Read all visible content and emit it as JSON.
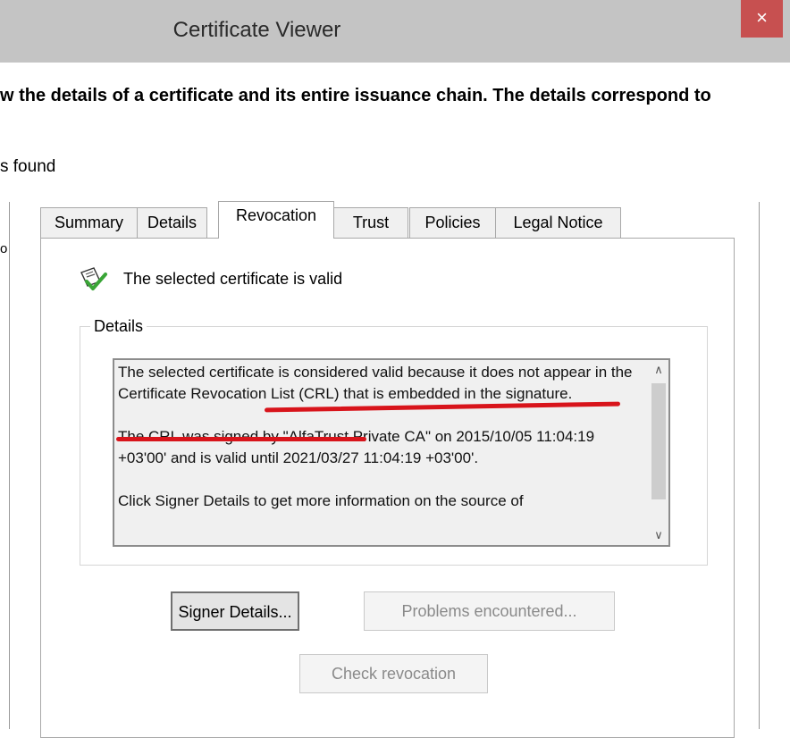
{
  "window": {
    "title": "Certificate Viewer",
    "close_label": "×"
  },
  "intro_text": "w the details of a certificate and its entire issuance chain. The details correspond to",
  "found_text": "s found",
  "left_glyph": "o",
  "tabs": [
    {
      "label": "Summary"
    },
    {
      "label": "Details"
    },
    {
      "label": "Revocation",
      "active": true
    },
    {
      "label": "Trust"
    },
    {
      "label": "Policies"
    },
    {
      "label": "Legal Notice"
    }
  ],
  "status": {
    "icon": "valid-certificate-icon",
    "text": "The selected certificate is valid"
  },
  "details": {
    "legend": "Details",
    "paragraph1": "The selected certificate is considered valid because it does not appear in the Certificate Revocation List (CRL) that is embedded in the signature.",
    "paragraph2": "The CRL was signed by \"AlfaTrust Private CA\" on 2015/10/05 11:04:19 +03'00' and is valid until 2021/03/27 11:04:19 +03'00'.",
    "paragraph3": "Click Signer Details to get more information on the source of"
  },
  "scroll": {
    "up_icon": "chevron-up-icon",
    "down_icon": "chevron-down-icon",
    "up_glyph": "∧",
    "down_glyph": "∨"
  },
  "buttons": {
    "signer_details": "Signer Details...",
    "problems": "Problems encountered...",
    "check_revocation": "Check revocation"
  },
  "colors": {
    "annotation": "#d8141b",
    "close_button": "#c75050",
    "titlebar": "#c4c4c4"
  }
}
